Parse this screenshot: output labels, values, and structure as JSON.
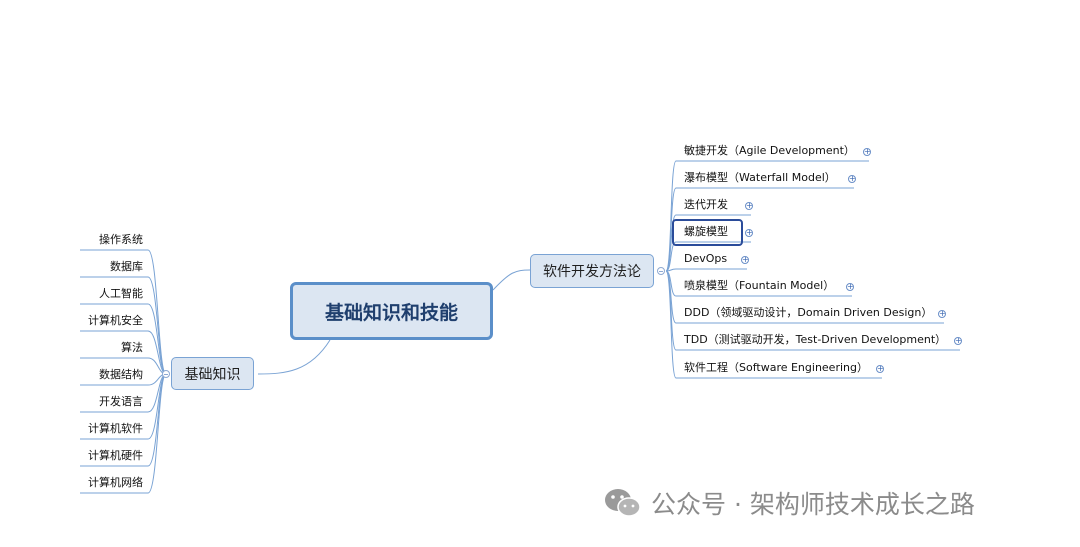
{
  "root": {
    "label": "基础知识和技能"
  },
  "left_branch": {
    "label": "基础知识",
    "leaves": [
      "操作系统",
      "数据库",
      "人工智能",
      "计算机安全",
      "算法",
      "数据结构",
      "开发语言",
      "计算机软件",
      "计算机硬件",
      "计算机网络"
    ]
  },
  "right_branch": {
    "label": "软件开发方法论",
    "leaves": [
      "敏捷开发（Agile Development）",
      "瀑布模型（Waterfall Model）",
      "迭代开发",
      "螺旋模型",
      "DevOps",
      "喷泉模型（Fountain Model）",
      "DDD（领域驱动设计，Domain Driven Design）",
      "TDD（测试驱动开发，Test-Driven Development）",
      "软件工程（Software Engineering）"
    ],
    "selected_leaf": "螺旋模型"
  },
  "watermark": {
    "text": "公众号 · 架构师技术成长之路",
    "icon": "wechat-icon"
  },
  "colors": {
    "line": "#7aa3d4",
    "node_fill": "#dce6f2",
    "root_border": "#5b8fc9",
    "selected_border": "#2b4c9a"
  }
}
